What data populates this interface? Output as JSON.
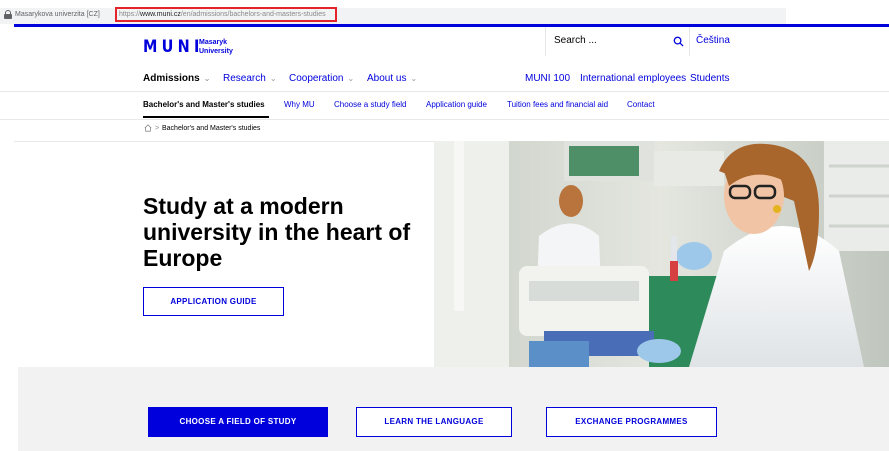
{
  "browser": {
    "site_identity": "Masarykova univerzita [CZ]",
    "url_prefix": "https://",
    "url_domain": "www.muni.cz",
    "url_path": "/en/admissions/bachelors-and-masters-studies"
  },
  "header": {
    "logo_letters": "MUNI",
    "logo_line1": "Masaryk",
    "logo_line2": "University",
    "search_placeholder": "Search ...",
    "language_link": "Čeština",
    "accent_color": "#0000dc"
  },
  "main_nav": {
    "admissions": "Admissions",
    "research": "Research",
    "cooperation": "Cooperation",
    "about": "About us",
    "muni100": "MUNI 100",
    "international": "International employees",
    "students": "Students"
  },
  "sub_nav": {
    "active": "Bachelor's and Master's studies",
    "why_mu": "Why MU",
    "choose_field": "Choose a study field",
    "application_guide": "Application guide",
    "tuition": "Tuition fees and financial aid",
    "contact": "Contact"
  },
  "breadcrumb": {
    "separator": ">",
    "current": "Bachelor's and Master's studies"
  },
  "hero": {
    "title": "Study at a modern university in the heart of Europe",
    "button": "APPLICATION GUIDE"
  },
  "actions": {
    "choose_field": "CHOOSE A FIELD OF STUDY",
    "learn_language": "LEARN THE LANGUAGE",
    "exchange": "EXCHANGE PROGRAMMES"
  }
}
